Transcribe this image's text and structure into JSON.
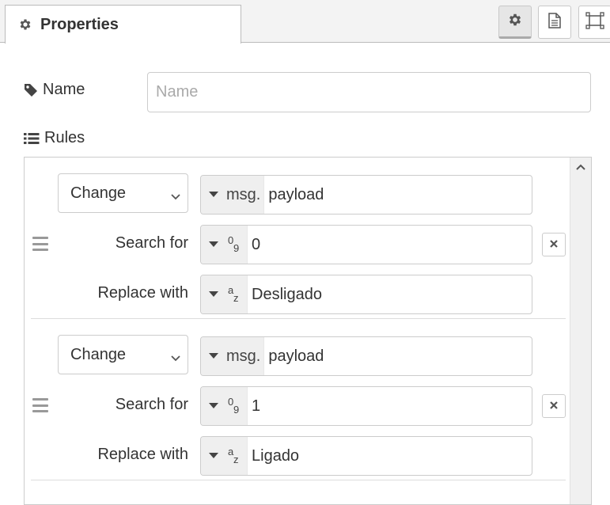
{
  "tabs": {
    "active_label": "Properties"
  },
  "toolbar": {
    "icons": [
      "gear-icon",
      "document-icon",
      "frame-icon"
    ]
  },
  "name_field": {
    "label": "Name",
    "placeholder": "Name",
    "value": ""
  },
  "rules_label": "Rules",
  "rules": [
    {
      "action": "Change",
      "target_prefix": "msg.",
      "target_value": "payload",
      "search_label": "Search for",
      "search_type_top": "0",
      "search_type_bottom": "9",
      "search_value": "0",
      "replace_label": "Replace with",
      "replace_type_top": "a",
      "replace_type_bottom": "z",
      "replace_value": "Desligado"
    },
    {
      "action": "Change",
      "target_prefix": "msg.",
      "target_value": "payload",
      "search_label": "Search for",
      "search_type_top": "0",
      "search_type_bottom": "9",
      "search_value": "1",
      "replace_label": "Replace with",
      "replace_type_top": "a",
      "replace_type_bottom": "z",
      "replace_value": "Ligado"
    }
  ]
}
